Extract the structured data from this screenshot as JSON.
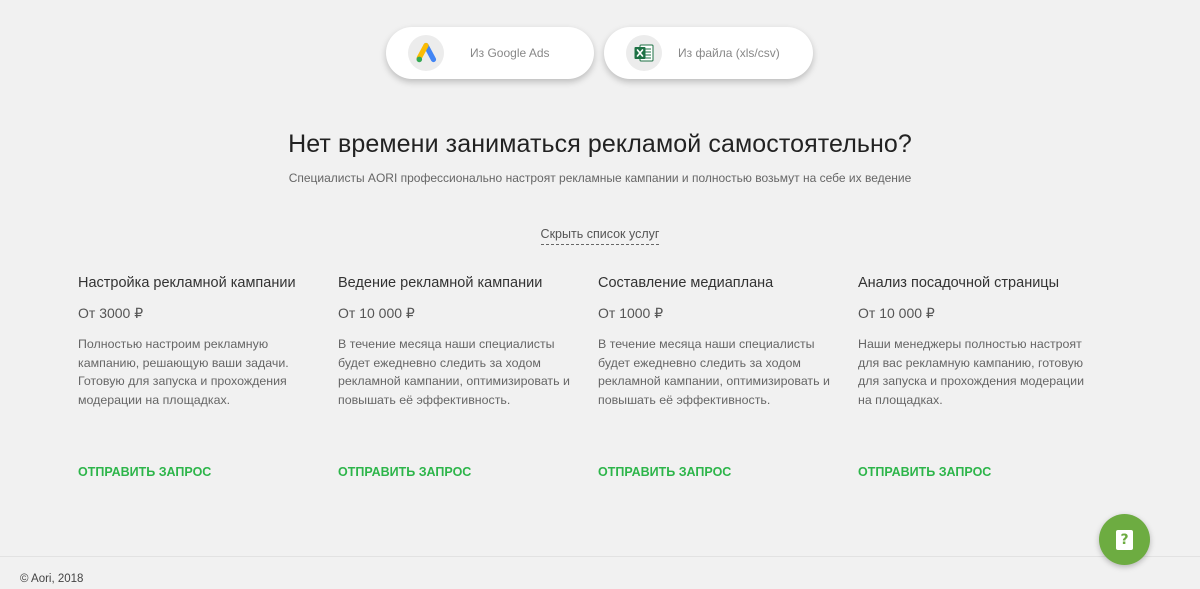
{
  "import": {
    "google_label": "Из Google Ads",
    "google_icon": "google-ads-icon",
    "file_label": "Из файла (xls/csv)",
    "file_icon": "excel-icon"
  },
  "promo": {
    "headline": "Нет времени заниматься рекламой самостоятельно?",
    "subline": "Специалисты AORI профессионально настроят рекламные кампании и полностью возьмут на себе их ведение",
    "toggle_label": "Скрыть список услуг"
  },
  "services": [
    {
      "title": "Настройка рекламной кампании",
      "price": "От 3000 ₽",
      "description": "Полностью настроим рекламную кампанию, решающую ваши задачи. Готовую для запуска и прохождения модерации на площадках.",
      "cta": "ОТПРАВИТЬ ЗАПРОС"
    },
    {
      "title": "Ведение рекламной кампании",
      "price": "От 10 000 ₽",
      "description": "В течение месяца наши специалисты будет ежедневно следить за ходом рекламной кампании, оптимизировать и повышать её эффективность.",
      "cta": "ОТПРАВИТЬ ЗАПРОС"
    },
    {
      "title": "Составление медиаплана",
      "price": "От 1000 ₽",
      "description": "В течение месяца наши специалисты будет ежедневно следить за ходом рекламной кампании, оптимизировать и повышать её эффективность.",
      "cta": "ОТПРАВИТЬ ЗАПРОС"
    },
    {
      "title": "Анализ посадочной страницы",
      "price": "От 10 000 ₽",
      "description": "Наши менеджеры полностью настроят для вас рекламную кампанию, готовую для запуска и прохождения модерации на площадках.",
      "cta": "ОТПРАВИТЬ ЗАПРОС"
    }
  ],
  "footer": {
    "copyright": "© Aori, 2018"
  },
  "help": {
    "icon": "help-question-icon",
    "glyph": "?"
  },
  "colors": {
    "background": "#f1f1f1",
    "accent_green": "#2db54a",
    "help_button": "#6dac41"
  }
}
